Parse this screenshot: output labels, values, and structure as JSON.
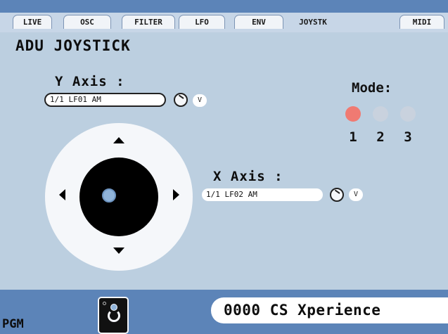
{
  "tabs": [
    {
      "label": "LIVE",
      "active": false
    },
    {
      "label": "OSC",
      "active": false
    },
    {
      "label": "FILTER",
      "active": false
    },
    {
      "label": "LFO",
      "active": false
    },
    {
      "label": "ENV",
      "active": false
    },
    {
      "label": "JOYSTK",
      "active": true
    },
    {
      "label": "MIDI",
      "active": false
    }
  ],
  "page_title": "ADU JOYSTICK",
  "y_axis": {
    "label": "Y Axis :",
    "source": "1/1  LF01 AM",
    "v_label": "V"
  },
  "x_axis": {
    "label": "X Axis :",
    "source": "1/1  LF02 AM",
    "v_label": "V"
  },
  "mode": {
    "label": "Mode:",
    "options": [
      "1",
      "2",
      "3"
    ],
    "selected": "1"
  },
  "footer": {
    "pgm_label": "PGM",
    "preset_name": "0000 CS Xperience"
  },
  "colors": {
    "accent_bar": "#5c84b8",
    "background": "#bccfe0",
    "mode_active": "#f07a72",
    "mode_inactive": "#c9d2de",
    "joystick_cursor": "#8fb3d9"
  },
  "icons": [
    "knob-icon",
    "arrow-up-icon",
    "arrow-down-icon",
    "arrow-left-icon",
    "arrow-right-icon",
    "joystick-program-icon"
  ]
}
